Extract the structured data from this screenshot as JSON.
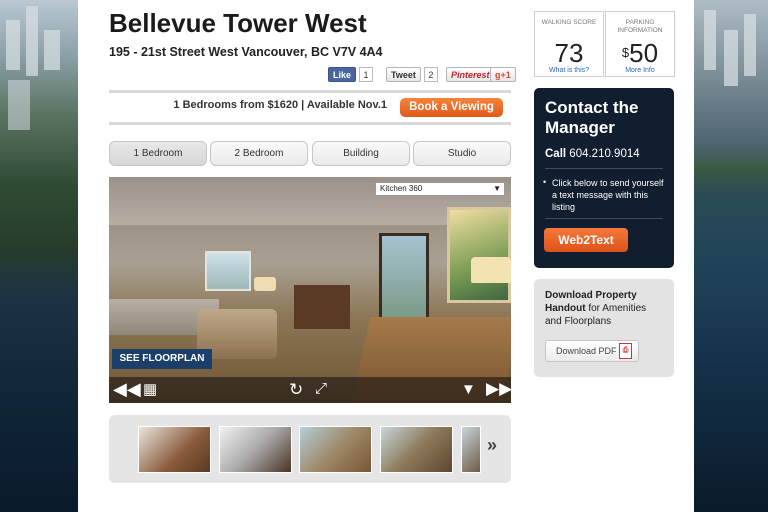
{
  "listing": {
    "title": "Bellevue Tower West",
    "address": "195 - 21st Street West Vancouver, BC V7V 4A4",
    "availability": "1 Bedrooms from $1620 | Available Nov.1",
    "book_label": "Book a Viewing"
  },
  "social": {
    "like_label": "Like",
    "like_count": "1",
    "tweet_label": "Tweet",
    "tweet_count": "2",
    "pinterest_label": "Pinterest",
    "gplus_label": "g+1"
  },
  "tabs": [
    {
      "label": "1 Bedroom",
      "active": true
    },
    {
      "label": "2 Bedroom",
      "active": false
    },
    {
      "label": "Building",
      "active": false
    },
    {
      "label": "Studio",
      "active": false
    }
  ],
  "viewer": {
    "selected_view": "Kitchen 360",
    "floorplan_label": "SEE FLOORPLAN"
  },
  "walking_score": {
    "label": "WALKING SCORE",
    "value": "73",
    "link": "What is this?"
  },
  "parking": {
    "label": "PARKING INFORMATION",
    "currency": "$",
    "value": "50",
    "link": "More Info"
  },
  "contact": {
    "heading": "Contact the Manager",
    "call_label": "Call",
    "phone": "604.210.9014",
    "message": "Click below to send yourself a text message with this listing",
    "button_label": "Web2Text"
  },
  "download": {
    "heading_bold": "Download Property Handout",
    "heading_rest": " for Amenities and Floorplans",
    "button_label": "Download PDF"
  },
  "colors": {
    "accent": "#e8621f",
    "navy": "#101e30",
    "link": "#2a66b8"
  }
}
